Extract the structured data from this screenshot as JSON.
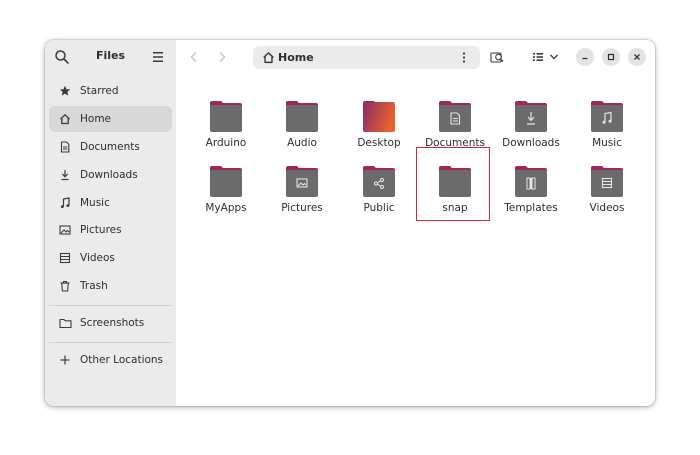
{
  "app": {
    "title": "Files"
  },
  "sidebar": {
    "items": [
      {
        "label": "Starred",
        "icon": "star-icon"
      },
      {
        "label": "Home",
        "icon": "home-icon",
        "selected": true
      },
      {
        "label": "Documents",
        "icon": "document-icon"
      },
      {
        "label": "Downloads",
        "icon": "download-icon"
      },
      {
        "label": "Music",
        "icon": "music-icon"
      },
      {
        "label": "Pictures",
        "icon": "picture-icon"
      },
      {
        "label": "Videos",
        "icon": "video-icon"
      },
      {
        "label": "Trash",
        "icon": "trash-icon"
      },
      {
        "label": "Screenshots",
        "icon": "folder-icon"
      },
      {
        "label": "Other Locations",
        "icon": "plus-icon"
      }
    ]
  },
  "pathbar": {
    "location": "Home"
  },
  "files": [
    {
      "name": "Arduino",
      "emblem": "none"
    },
    {
      "name": "Audio",
      "emblem": "none"
    },
    {
      "name": "Desktop",
      "emblem": "desktop"
    },
    {
      "name": "Documents",
      "emblem": "document"
    },
    {
      "name": "Downloads",
      "emblem": "download"
    },
    {
      "name": "Music",
      "emblem": "music"
    },
    {
      "name": "MyApps",
      "emblem": "none"
    },
    {
      "name": "Pictures",
      "emblem": "picture"
    },
    {
      "name": "Public",
      "emblem": "share"
    },
    {
      "name": "snap",
      "emblem": "none",
      "highlighted": true
    },
    {
      "name": "Templates",
      "emblem": "template"
    },
    {
      "name": "Videos",
      "emblem": "video"
    }
  ],
  "colors": {
    "folder_body": "#6b6b6b",
    "folder_tab": "#a3265b",
    "desktop_gradient": [
      "#8b2a6d",
      "#e8622a"
    ],
    "highlight": "#d02a2a"
  }
}
